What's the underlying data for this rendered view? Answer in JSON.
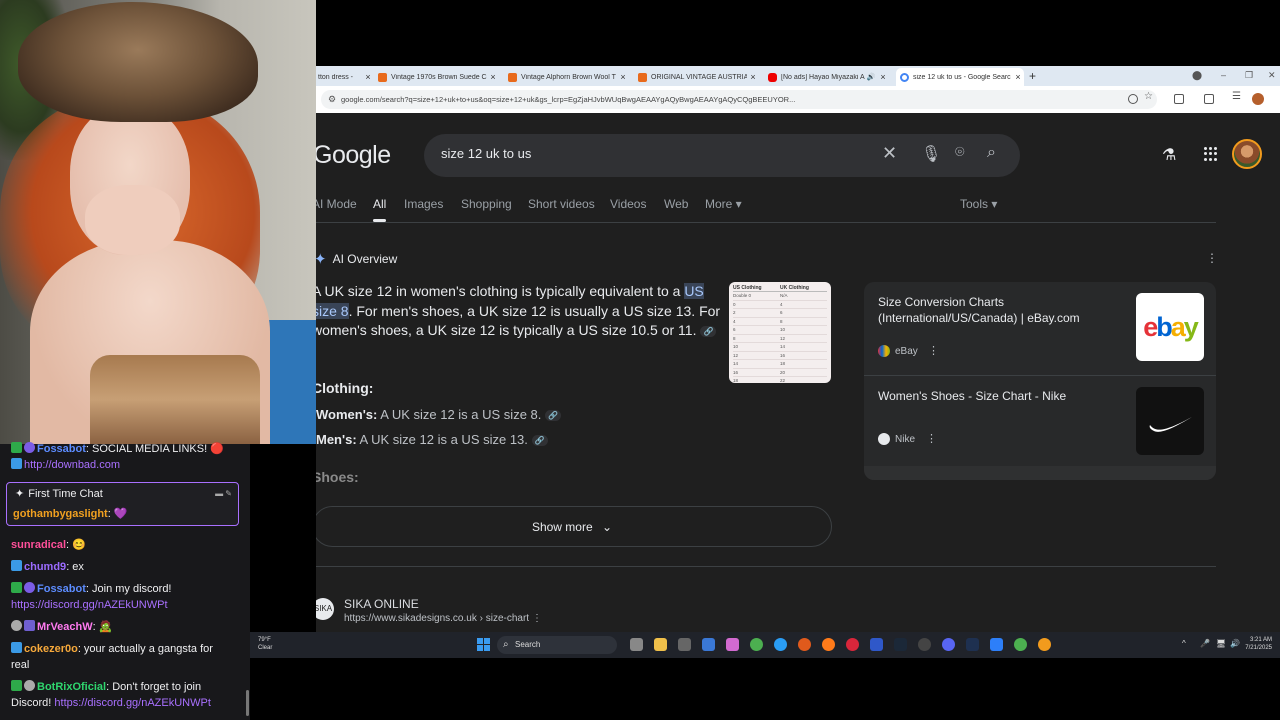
{
  "browser": {
    "tabs": [
      {
        "title": "tton dress -",
        "favicon": "none",
        "active": false
      },
      {
        "title": "Vintage 1970s Brown Suede Co",
        "favicon": "etsy",
        "active": false
      },
      {
        "title": "Vintage Alphorn Brown Wool T",
        "favicon": "etsy",
        "active": false
      },
      {
        "title": "ORIGINAL VINTAGE AUSTRIAN",
        "favicon": "etsy",
        "active": false
      },
      {
        "title": "[No ads] Hayao Miyazaki A",
        "favicon": "youtube",
        "active": false
      },
      {
        "title": "size 12 uk to us - Google Searc",
        "favicon": "google",
        "active": true
      }
    ],
    "close_glyph": "×",
    "new_tab_glyph": "+",
    "url": "google.com/search?q=size+12+uk+to+us&oq=size+12+uk&gs_lcrp=EgZjaHJvbWUqBwgAEAAYgAQyBwgAEAAYgAQyCQgBEEUYOR...",
    "window_controls": [
      "–",
      "❐",
      "✕"
    ]
  },
  "google": {
    "logo": "Google",
    "query": "size 12 uk to us",
    "nav_tabs": [
      "AI Mode",
      "All",
      "Images",
      "Shopping",
      "Short videos",
      "Videos",
      "Web",
      "More ▾",
      "Tools ▾"
    ],
    "active_tab": "All",
    "ai_overview_label": "AI Overview",
    "ai_text": {
      "p1": "A UK size 12 in women's clothing is typically equivalent to a ",
      "highlight": "US size 8",
      "p2": ". For men's shoes, a UK size 12 is usually a US size 13. For women's shoes, a UK size 12 is typically a US size 10.5 or 11."
    },
    "thumbnail": {
      "headers": [
        "US Clothing",
        "UK Clothing"
      ],
      "rows": [
        [
          "Double 0",
          "N/A"
        ],
        [
          "0",
          "4"
        ],
        [
          "2",
          "6"
        ],
        [
          "4",
          "8"
        ],
        [
          "6",
          "10"
        ],
        [
          "8",
          "12"
        ],
        [
          "10",
          "14"
        ],
        [
          "12",
          "16"
        ],
        [
          "14",
          "18"
        ],
        [
          "16",
          "20"
        ],
        [
          "18",
          "22"
        ]
      ]
    },
    "clothing_heading": "Clothing:",
    "bullets": [
      {
        "label": "Women's:",
        "text": " A UK size 12 is a US size 8."
      },
      {
        "label": "Men's:",
        "text": " A UK size 12 is a US size 13."
      }
    ],
    "shoes_heading": "Shoes:",
    "show_more": "Show more",
    "sources": [
      {
        "title": "Size Conversion Charts (International/US/Canada) | eBay.com",
        "site": "eBay",
        "favicon_color": "#e53238"
      },
      {
        "title": "Women's Shoes - Size Chart - Nike",
        "site": "Nike",
        "favicon_color": "#e8eaed"
      }
    ],
    "ebay_logo": {
      "e": "e",
      "b": "b",
      "a": "a",
      "y": "y"
    },
    "result": {
      "logo": "SIKA",
      "name": "SIKA ONLINE",
      "url": "https://www.sikadesigns.co.uk › size-chart"
    }
  },
  "taskbar": {
    "weather_temp": "79°F",
    "weather_desc": "Clear",
    "search_label": "Search",
    "time": "3:21 AM",
    "date": "7/21/2025"
  },
  "chat": {
    "messages": [
      {
        "user": "Fossabot",
        "color": "#5c8cff",
        "badges": [
          "check",
          "vip"
        ],
        "text": ": SOCIAL MEDIA LINKS! 🔴"
      },
      {
        "user": "",
        "color": "#a970ff",
        "badges": [
          "sub"
        ],
        "link": "http://downbad.com"
      },
      {
        "user": "sunradical",
        "color": "#ff4f9a",
        "badges": [],
        "text": ": 😊"
      },
      {
        "user": "chumd9",
        "color": "#9b6bff",
        "badges": [
          "sub"
        ],
        "text": ": ex"
      },
      {
        "user": "Fossabot",
        "color": "#5c8cff",
        "badges": [
          "check",
          "vip"
        ],
        "text": ": Join my discord!"
      },
      {
        "user": "",
        "color": "#a970ff",
        "badges": [],
        "link": "https://discord.gg/nAZEkUNWPt"
      },
      {
        "user": "MrVeachW",
        "color": "#ff7af0",
        "badges": [
          "skull",
          "gift"
        ],
        "text": ": 🧟"
      },
      {
        "user": "cokezer0o",
        "color": "#f7a93b",
        "badges": [
          "sub"
        ],
        "text": ": your actually a gangsta for"
      },
      {
        "user": "",
        "color": "#efeff1",
        "badges": [],
        "text": "real"
      },
      {
        "user": "BotRixOficial",
        "color": "#2fd56e",
        "badges": [
          "check",
          "skull"
        ],
        "text": ": Don't forget to join"
      },
      {
        "user": "",
        "color": "#efeff1",
        "badges": [],
        "text": "Discord! ",
        "link": "https://discord.gg/nAZEkUNWPt"
      }
    ],
    "first_time_chat": {
      "label": "First Time Chat",
      "user": "gothambygaslight",
      "text": ": 💜"
    }
  }
}
